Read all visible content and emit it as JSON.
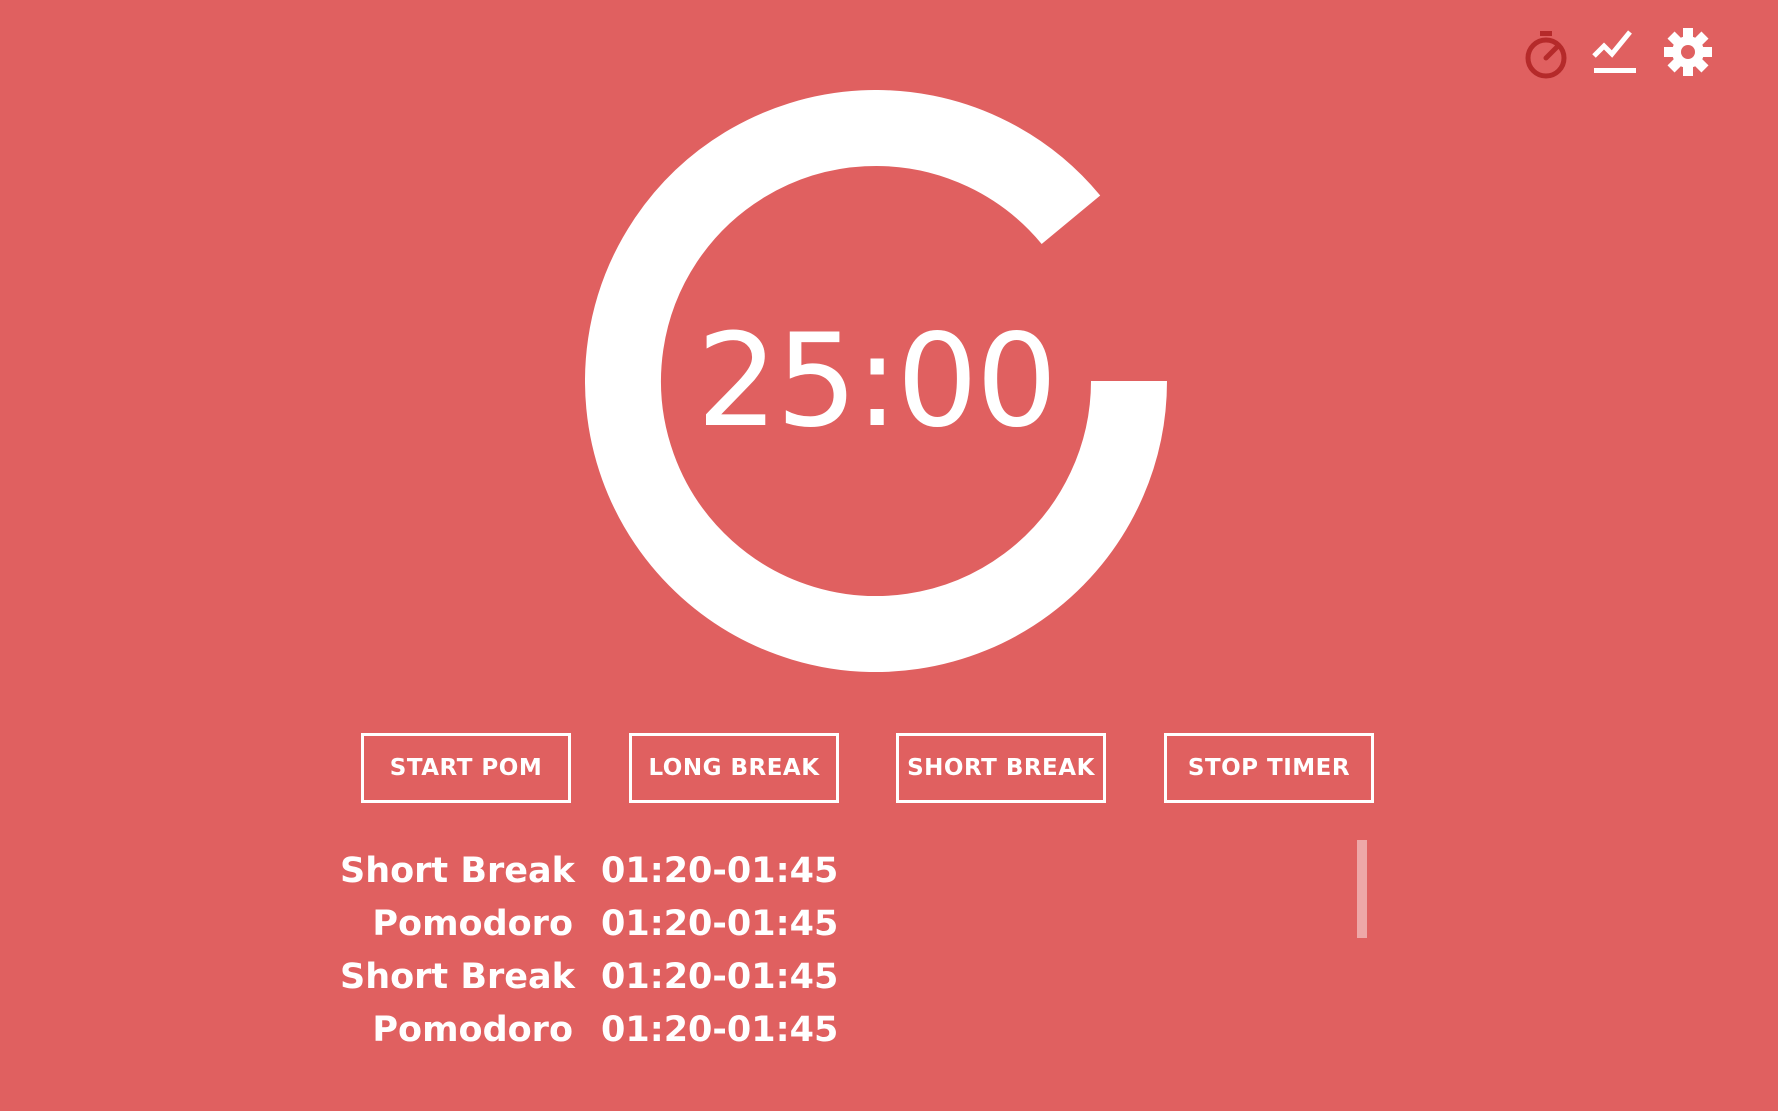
{
  "colors": {
    "background": "#e06060",
    "foreground": "#ffffff",
    "active_icon": "#b52a2a"
  },
  "top_icons": [
    {
      "name": "timer-icon",
      "active": true
    },
    {
      "name": "stats-chart-icon",
      "active": false
    },
    {
      "name": "gear-icon",
      "active": false
    }
  ],
  "timer": {
    "display": "25:00",
    "progress": 0.89
  },
  "controls": {
    "start_pom": "START POM",
    "long_break": "LONG BREAK",
    "short_break": "SHORT BREAK",
    "stop_timer": "STOP TIMER"
  },
  "history": [
    {
      "type": "Short Break",
      "time": "01:20-01:45"
    },
    {
      "type": "Pomodoro",
      "time": "01:20-01:45"
    },
    {
      "type": "Short Break",
      "time": "01:20-01:45"
    },
    {
      "type": "Pomodoro",
      "time": "01:20-01:45"
    }
  ]
}
